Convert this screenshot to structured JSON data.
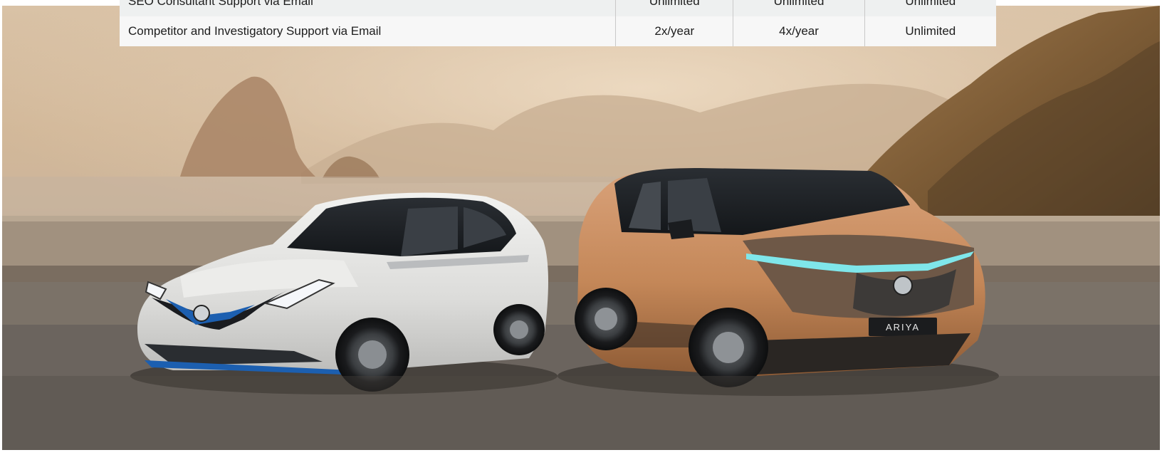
{
  "table": {
    "rows": [
      {
        "feature": "SEO Consultant Support via Email",
        "plan1": "Unlimited",
        "plan2": "Unlimited",
        "plan3": "Unlimited"
      },
      {
        "feature": "Competitor and Investigatory Support via Email",
        "plan1": "2x/year",
        "plan2": "4x/year",
        "plan3": "Unlimited"
      }
    ]
  },
  "hero": {
    "plate_text": "ARIYA",
    "colors": {
      "sky": "#d9c2a6",
      "road": "#6b645e",
      "white_car": "#e6e6e4",
      "copper_car": "#c98d62",
      "accent_blue": "#1c5fb0",
      "led_cyan": "#7fe6ea"
    }
  }
}
